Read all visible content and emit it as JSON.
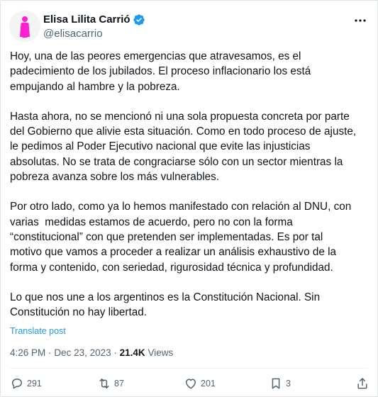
{
  "author": {
    "display_name": "Elisa Lilita Carrió",
    "handle": "@elisacarrio"
  },
  "tweet": {
    "paragraphs": [
      "Hoy, una de las peores emergencias que atravesamos, es el\npadecimiento de los jubilados. El proceso inflacionario los está\nempujando al hambre y la pobreza.",
      "Hasta ahora, no se mencionó ni una sola propuesta concreta por parte\ndel Gobierno que alivie esta situación. Como en todo proceso de ajuste,\nle pedimos al Poder Ejecutivo nacional que evite las injusticias\nabsolutas. No se trata de congraciarse sólo con un sector mientras la\npobreza avanza sobre los más vulnerables.",
      "Por otro lado, como ya lo hemos manifestado con relación al DNU, con\nvarias  medidas estamos de acuerdo, pero no con la forma\n“constitucional” con que pretenden ser implementadas. Es por tal\nmotivo que vamos a proceder a realizar un análisis exhaustivo de la\nforma y contenido, con seriedad, rigurosidad técnica y profundidad.",
      "Lo que nos une a los argentinos es la Constitución Nacional. Sin\nConstitución no hay libertad."
    ],
    "translate_label": "Translate post",
    "time": "4:26 PM",
    "separator": "·",
    "date": "Dec 23, 2023",
    "views_count": "21.4K",
    "views_label": "Views"
  },
  "actions": {
    "replies": "291",
    "reposts": "87",
    "likes": "201",
    "bookmarks": "3"
  },
  "colors": {
    "accent": "#1d9bf0",
    "avatar_figure": "#ff1fd0",
    "text_secondary": "#536471"
  },
  "icons": {
    "verified": "verified-badge-icon",
    "more": "more-options-icon",
    "reply": "reply-icon",
    "repost": "repost-icon",
    "like": "heart-icon",
    "bookmark": "bookmark-icon",
    "share": "share-icon"
  }
}
